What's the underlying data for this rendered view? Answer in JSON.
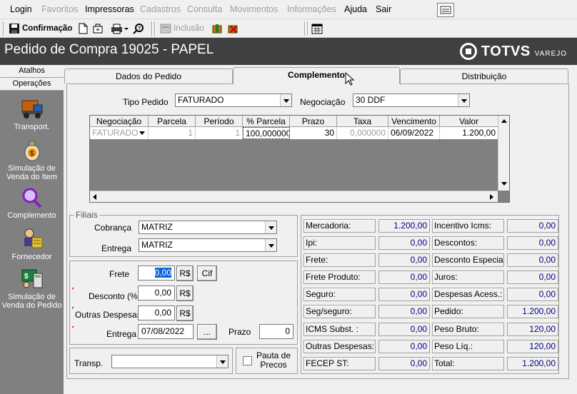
{
  "menu": {
    "items": [
      {
        "label": "Login",
        "enabled": true
      },
      {
        "label": "Favoritos",
        "enabled": false
      },
      {
        "label": "Impressoras",
        "enabled": true
      },
      {
        "label": "Cadastros",
        "enabled": false
      },
      {
        "label": "Consulta",
        "enabled": false
      },
      {
        "label": "Movimentos",
        "enabled": false
      },
      {
        "label": "Informações",
        "enabled": false
      },
      {
        "label": "Ajuda",
        "enabled": true
      },
      {
        "label": "Sair",
        "enabled": true
      }
    ]
  },
  "toolbar": {
    "confirm_label": "Confirmação",
    "include_label": "Inclusão"
  },
  "title": {
    "text": "Pedido de Compra  19025 - PAPEL",
    "logo_main": "TOTVS",
    "logo_sub": "VAREJO"
  },
  "sidebar": {
    "tab_atalhos": "Atalhos",
    "tab_operacoes": "Operações",
    "items": [
      {
        "label": "Transport.",
        "icon": "truck-icon"
      },
      {
        "label": "Simulação de Venda do Item",
        "icon": "money-bag-icon"
      },
      {
        "label": "Complemento",
        "icon": "magnifier-icon"
      },
      {
        "label": "Fornecedor",
        "icon": "supplier-icon"
      },
      {
        "label": "Simulação de Venda do Pedido",
        "icon": "calculator-board-icon"
      }
    ]
  },
  "tabs": [
    {
      "label": "Dados do Pedido",
      "active": false
    },
    {
      "label": "Complemento",
      "active": true
    },
    {
      "label": "Distribuição",
      "active": false
    }
  ],
  "form": {
    "tipo_pedido_label": "Tipo Pedido",
    "tipo_pedido_value": "FATURADO",
    "negociacao_label": "Negociação",
    "negociacao_value": "30 DDF"
  },
  "grid": {
    "headers": [
      "Negociação",
      "Parcela",
      "Período",
      "% Parcela",
      "Prazo",
      "Taxa",
      "Vencimento",
      "Valor"
    ],
    "row": [
      "FATURADO",
      "1",
      "1",
      "100,000000",
      "30",
      "0,000000",
      "06/09/2022",
      "1.200,00"
    ]
  },
  "filiais": {
    "group_label": "Filiais",
    "cobranca_label": "Cobrança",
    "cobranca_value": "MATRIZ",
    "entrega_label": "Entrega",
    "entrega_value": "MATRIZ"
  },
  "frete": {
    "frete_label": "Frete",
    "frete_value": "0,00",
    "rs_label": "R$",
    "cif_label": "Cif",
    "desconto_label": "Desconto (%)",
    "desconto_value": "0,00",
    "outras_label": "Outras Despesas:",
    "outras_value": "0,00",
    "entrega_label": "Entrega",
    "entrega_value": "07/08/2022",
    "ellipsis": "...",
    "prazo_label": "Prazo",
    "prazo_value": "0"
  },
  "transp": {
    "label": "Transp.",
    "value": "",
    "pauta_label": "Pauta de Precos"
  },
  "totals": {
    "left": [
      {
        "label": "Mercadoria:",
        "value": "1.200,00"
      },
      {
        "label": "Ipi:",
        "value": "0,00"
      },
      {
        "label": "Frete:",
        "value": "0,00"
      },
      {
        "label": "Frete Produto:",
        "value": "0,00"
      },
      {
        "label": "Seguro:",
        "value": "0,00"
      },
      {
        "label": "Seg/seguro:",
        "value": "0,00"
      },
      {
        "label": "ICMS Subst. :",
        "value": "0,00"
      },
      {
        "label": "Outras Despesas:",
        "value": "0,00"
      },
      {
        "label": "FECEP ST:",
        "value": "0,00"
      }
    ],
    "right": [
      {
        "label": "Incentivo Icms:",
        "value": "0,00"
      },
      {
        "label": "Descontos:",
        "value": "0,00"
      },
      {
        "label": "Desconto Especial:",
        "value": "0,00"
      },
      {
        "label": "Juros:",
        "value": "0,00"
      },
      {
        "label": "Despesas Acess.:",
        "value": "0,00"
      },
      {
        "label": "Pedido:",
        "value": "1.200,00"
      },
      {
        "label": "Peso Bruto:",
        "value": "120,00"
      },
      {
        "label": "Peso Líq.:",
        "value": "120,00"
      },
      {
        "label": "Total:",
        "value": "1.200,00"
      }
    ]
  },
  "colors": {
    "title_bg": "#404040",
    "sidebar_bg": "#808080",
    "total_value": "#000080"
  }
}
